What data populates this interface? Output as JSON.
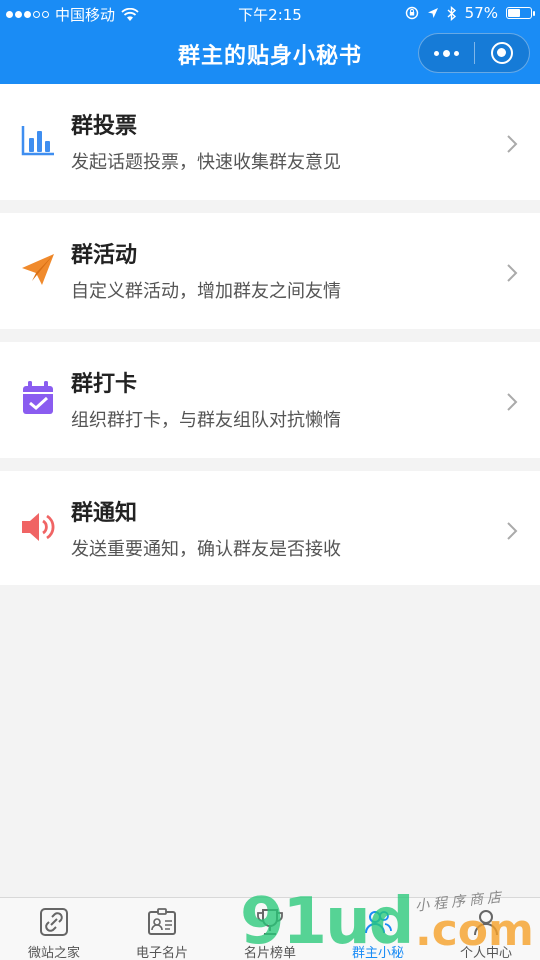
{
  "status_bar": {
    "carrier": "中国移动",
    "time": "下午2:15",
    "battery": "57%",
    "battery_level": 0.57
  },
  "nav": {
    "title": "群主的贴身小秘书",
    "more_icon": "more-dots-icon",
    "close_icon": "target-icon"
  },
  "items": [
    {
      "title": "群投票",
      "desc": "发起话题投票，快速收集群友意见",
      "icon": "bar-chart-icon",
      "color": "#3f8ef0"
    },
    {
      "title": "群活动",
      "desc": "自定义群活动，增加群友之间友情",
      "icon": "paper-plane-icon",
      "color": "#f08a2c"
    },
    {
      "title": "群打卡",
      "desc": "组织群打卡，与群友组队对抗懒惰",
      "icon": "calendar-check-icon",
      "color": "#8a5cf0"
    },
    {
      "title": "群通知",
      "desc": "发送重要通知，确认群友是否接收",
      "icon": "speaker-icon",
      "color": "#f06464"
    }
  ],
  "tabs": [
    {
      "label": "微站之家",
      "icon": "link-icon",
      "active": false
    },
    {
      "label": "电子名片",
      "icon": "business-card-icon",
      "active": false
    },
    {
      "label": "名片榜单",
      "icon": "trophy-icon",
      "active": false
    },
    {
      "label": "群主小秘",
      "icon": "group-icon",
      "active": true
    },
    {
      "label": "个人中心",
      "icon": "person-icon",
      "active": false
    }
  ],
  "watermark": {
    "number": "91ud",
    "suffix": ".com",
    "handwriting": "小程序商店"
  },
  "colors": {
    "accent": "#1a8cf5",
    "background": "#f3f3f3"
  }
}
